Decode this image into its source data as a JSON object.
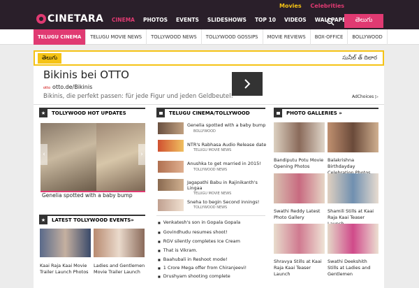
{
  "top_links": {
    "movies": "Movies",
    "celebrities": "Celebrities"
  },
  "brand": {
    "name": "CINETARA"
  },
  "main_nav": [
    "CINEMA",
    "PHOTOS",
    "EVENTS",
    "SLIDESHOWS",
    "TOP 10",
    "VIDEOS",
    "WALLPAPERS"
  ],
  "lang_button": "తెలుగు",
  "sub_nav": [
    "TELUGU CINEMA",
    "TELUGU MOVIE NEWS",
    "TOLLYWOOD NEWS",
    "TOLLYWOOD GOSSIPS",
    "MOVIE REVIEWS",
    "BOX-OFFICE",
    "BOLLYWOOD"
  ],
  "telugu_bar": {
    "badge": "తెలుగు",
    "ticker": "సునీల్ త్‌ దిలార"
  },
  "ad": {
    "title": "Bikinis bei OTTO",
    "badge": "otto",
    "url": "otto.de/Bikinis",
    "desc": "Bikinis, die perfekt passen: für jede Figur und jeden Geldbeutel!",
    "adchoices": "AdChoices"
  },
  "hot_updates": {
    "heading": "TOLLYWOOD HOT UPDATES",
    "caption": "Genelia spotted with a baby bump"
  },
  "events": {
    "heading": "LATEST TOLLYWOOD EVENTS»",
    "items": [
      "Kaai Raja Kaai Movie Trailer Launch Photos",
      "Ladies and Gentlemen Movie Trailer Launch"
    ]
  },
  "telugu_cinema": {
    "heading": "TELUGU CINEMA/TOLLYWOOD",
    "news": [
      {
        "title": "Genelia spotted with a baby bump",
        "cat": "BOLLYWOOD"
      },
      {
        "title": "NTR's Rabhasa Audio Release date",
        "cat": "TELUGU MOVIE NEWS"
      },
      {
        "title": "Anushka to get married in 2015!",
        "cat": "TOLLYWOOD NEWS"
      },
      {
        "title": "Jagapathi Babu in Rajinikanth's Lingaa",
        "cat": "TELUGU MOVIE NEWS"
      },
      {
        "title": "Sneha to begin Second innings!",
        "cat": "TOLLYWOOD NEWS"
      }
    ],
    "bullets": [
      "Venkatesh's son in Gopala Gopala",
      "Govindhudu resumes shoot!",
      "RGV silently completes Ice Cream",
      "That is Vikram.",
      "Baahubali in Reshoot mode!",
      "1 Crore Mega offer from Chiranjeevi!",
      "Drushyam shooting complete"
    ]
  },
  "galleries": {
    "heading": "PHOTO GALLERIES »",
    "items": [
      "Bandiputu Potu Movie Opening Photos",
      "Balakrishna Birthdayday Celebration Photos",
      "Swathi Reddy Latest Photo Gallery",
      "Shamili Stills at Kaai Raja Kaai Teaser Launch",
      "Shravya Stills at Kaai Raja Kaai Teaser Launch",
      "Swathi Deekshith Stills at Ladies and Gentlemen"
    ]
  },
  "colors": {
    "accent": "#e03a72",
    "dark": "#2a1f2a",
    "yellow": "#f5c315"
  }
}
